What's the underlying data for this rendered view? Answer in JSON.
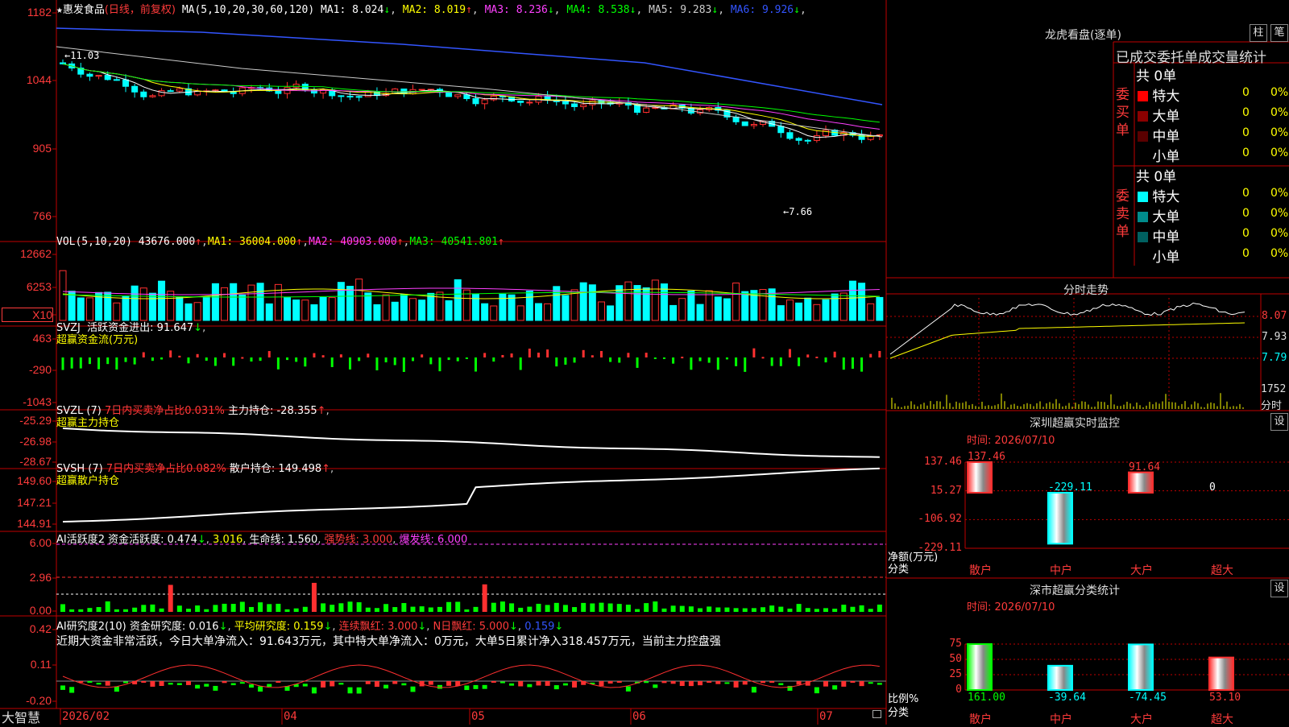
{
  "stock": {
    "name": "惠发食品",
    "period": "(日线，前复权)"
  },
  "ma_header": {
    "label": "MA(5,10,20,30,60,120)",
    "items": [
      {
        "k": "MA1",
        "v": "8.024",
        "arrow": "↓",
        "color": "#ffffff"
      },
      {
        "k": "MA2",
        "v": "8.019",
        "arrow": "↑",
        "color": "#ffff00"
      },
      {
        "k": "MA3",
        "v": "8.236",
        "arrow": "↓",
        "color": "#ff40ff"
      },
      {
        "k": "MA4",
        "v": "8.538",
        "arrow": "↓",
        "color": "#00ff00"
      },
      {
        "k": "MA5",
        "v": "9.283",
        "arrow": "↓",
        "color": "#cccccc"
      },
      {
        "k": "MA6",
        "v": "9.926",
        "arrow": "↓",
        "color": "#3355ff"
      }
    ]
  },
  "price_axis": [
    "1182",
    "1044",
    "905",
    "766"
  ],
  "price_high_label": "11.03",
  "price_low_label": "7.66",
  "vol_header": {
    "label": "VOL(5,10,20)",
    "value": "43676.000",
    "ma1": "36004.000",
    "ma2": "40903.000",
    "ma3": "40541.801"
  },
  "vol_axis": [
    "12662",
    "6253",
    "X10"
  ],
  "svzj": {
    "label": "SVZJ",
    "text": "活跃资金进出: 91.647",
    "arrow": "↓",
    "sub": "超赢资金流(万元)",
    "axis": [
      "463",
      "-290",
      "-1043"
    ]
  },
  "svzl": {
    "label": "SVZL (7)",
    "red": "7日内买卖净占比0.031%",
    "text": "主力持仓: -28.355",
    "arrow": "↑",
    "sub": "超赢主力持仓",
    "axis": [
      "-25.29",
      "-26.98",
      "-28.67"
    ]
  },
  "svsh": {
    "label": "SVSH (7)",
    "red": "7日内买卖净占比0.082%",
    "text": "散户持仓: 149.498",
    "arrow": "↑",
    "sub": "超赢散户持仓",
    "axis": [
      "149.60",
      "147.21",
      "144.91"
    ]
  },
  "ai_active": {
    "label": "AI活跃度2",
    "t1": "资金活跃度: 0.474",
    "t2": "3.016",
    "t3": "生命线: 1.560",
    "t4": "强势线: 3.000",
    "t5": "爆发线: 6.000",
    "axis": [
      "6.00",
      "2.96",
      "0.00"
    ]
  },
  "ai_research": {
    "label": "AI研究度2(10)",
    "t1": "资金研究度: 0.016",
    "t2": "平均研究度: 0.159",
    "t3": "连续飘红: 3.000",
    "t4": "N日飘红: 5.000",
    "t5": "0.159",
    "axis": [
      "0.42",
      "0.11",
      "-0.20"
    ],
    "comment": "近期大资金非常活跃，今日大单净流入：91.643万元，其中特大单净流入：0万元，大单5日累计净入318.457万元，当前主力控盘强"
  },
  "x_axis": {
    "brand": "大智慧",
    "labels": [
      "2026/02",
      "04",
      "05",
      "06",
      "07"
    ]
  },
  "dragon": {
    "title": "龙虎看盘(逐单)",
    "btn1": "柱",
    "btn2": "笔",
    "subtitle": "已成交委托单成交量统计",
    "buy_label": "委买单",
    "sell_label": "委卖单",
    "buy_total": "共 0单",
    "sell_total": "共 0单",
    "rows": [
      "特大",
      "大单",
      "中单",
      "小单"
    ],
    "buy": [
      {
        "v": "0",
        "p": "0%"
      },
      {
        "v": "0",
        "p": "0%"
      },
      {
        "v": "0",
        "p": "0%"
      },
      {
        "v": "0",
        "p": "0%"
      }
    ],
    "sell": [
      {
        "v": "0",
        "p": "0%"
      },
      {
        "v": "0",
        "p": "0%"
      },
      {
        "v": "0",
        "p": "0%"
      },
      {
        "v": "0",
        "p": "0%"
      }
    ],
    "buy_colors": [
      "#ff0000",
      "#8b0000",
      "#5a0000",
      ""
    ],
    "sell_colors": [
      "#00ffff",
      "#008b8b",
      "#006060",
      ""
    ]
  },
  "intraday": {
    "title": "分时走势",
    "axis": [
      "8.07",
      "7.93",
      "7.79"
    ],
    "vol": "1752",
    "vol_unit": "分时"
  },
  "monitor": {
    "title": "深圳超赢实时监控",
    "btn": "设",
    "time": "时间: 2026/07/10",
    "axis": [
      "137.46",
      "15.27",
      "-106.92",
      "-229.11"
    ],
    "ylabel": "净额(万元)",
    "xlabel": "分类",
    "categories": [
      "散户",
      "中户",
      "大户",
      "超大"
    ],
    "values": [
      137.46,
      -229.11,
      91.64,
      0
    ],
    "value_labels": [
      "137.46",
      "-229.11",
      "91.64",
      "0"
    ]
  },
  "classify": {
    "title": "深市超赢分类统计",
    "btn": "设",
    "time": "时间: 2026/07/10",
    "axis": [
      "75",
      "50",
      "25",
      "0"
    ],
    "ylabel": "比例%",
    "xlabel": "分类",
    "categories": [
      "散户",
      "中户",
      "大户",
      "超大"
    ],
    "values": [
      161.0,
      -39.64,
      -74.45,
      53.1
    ],
    "value_labels": [
      "161.00",
      "-39.64",
      "-74.45",
      "53.10"
    ]
  },
  "chart_data": [
    {
      "type": "bar",
      "title": "深圳超赢实时监控",
      "xlabel": "分类",
      "ylabel": "净额(万元)",
      "categories": [
        "散户",
        "中户",
        "大户",
        "超大"
      ],
      "values": [
        137.46,
        -229.11,
        91.64,
        0
      ],
      "ylim": [
        -229.11,
        137.46
      ]
    },
    {
      "type": "bar",
      "title": "深市超赢分类统计",
      "xlabel": "分类",
      "ylabel": "比例%",
      "categories": [
        "散户",
        "中户",
        "大户",
        "超大"
      ],
      "values": [
        161.0,
        -39.64,
        -74.45,
        53.1
      ],
      "ylim": [
        0,
        75
      ]
    }
  ]
}
